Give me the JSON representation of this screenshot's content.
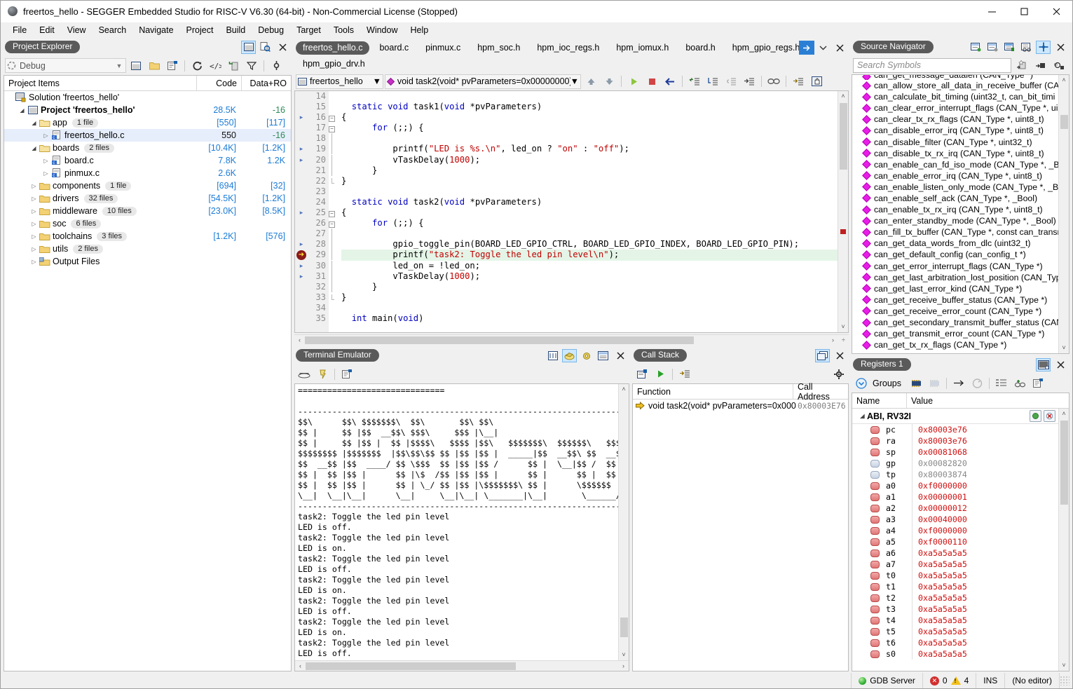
{
  "window": {
    "title": "freertos_hello - SEGGER Embedded Studio for RISC-V V6.30 (64-bit) - Non-Commercial License (Stopped)",
    "app_icon": "segger-icon",
    "minimize": "minimize-icon",
    "maximize": "maximize-icon",
    "close": "close-icon"
  },
  "menubar": [
    "File",
    "Edit",
    "View",
    "Search",
    "Navigate",
    "Project",
    "Build",
    "Debug",
    "Target",
    "Tools",
    "Window",
    "Help"
  ],
  "project_explorer": {
    "title": "Project Explorer",
    "config": "Debug",
    "config_arrow": "▼",
    "columns": [
      "Project Items",
      "Code",
      "Data+RO"
    ],
    "head_icons": [
      "properties-window-icon",
      "search-file-icon",
      "close-icon"
    ],
    "toolbar_icons": [
      "new-item-icon",
      "new-folder-icon",
      "edit-options-icon",
      "refresh-icon",
      "code-icon",
      "import-icon",
      "filter-icon",
      "settings-icon"
    ],
    "rows": [
      {
        "indent": 0,
        "arrow": "",
        "icon": "solution-icon",
        "label": "Solution 'freertos_hello'",
        "badge": "",
        "code": "",
        "data": "",
        "bold": false,
        "selected": false
      },
      {
        "indent": 1,
        "arrow": "open",
        "icon": "project-icon",
        "label": "Project 'freertos_hello'",
        "badge": "",
        "code": "28.5K",
        "data": "-16",
        "bold": true,
        "selected": false
      },
      {
        "indent": 2,
        "arrow": "open",
        "icon": "folder-open-icon",
        "label": "app",
        "badge": "1 file",
        "code": "[550]",
        "data": "[117]",
        "bold": false,
        "selected": false
      },
      {
        "indent": 3,
        "arrow": "closed",
        "icon": "c-file-icon",
        "label": "freertos_hello.c",
        "badge": "",
        "code": "550",
        "data": "-16",
        "bold": false,
        "selected": true
      },
      {
        "indent": 2,
        "arrow": "open",
        "icon": "folder-open-icon",
        "label": "boards",
        "badge": "2 files",
        "code": "[10.4K]",
        "data": "[1.2K]",
        "bold": false,
        "selected": false
      },
      {
        "indent": 3,
        "arrow": "closed",
        "icon": "c-file-icon",
        "label": "board.c",
        "badge": "",
        "code": "7.8K",
        "data": "1.2K",
        "bold": false,
        "selected": false
      },
      {
        "indent": 3,
        "arrow": "closed",
        "icon": "c-file-icon",
        "label": "pinmux.c",
        "badge": "",
        "code": "2.6K",
        "data": "",
        "bold": false,
        "selected": false
      },
      {
        "indent": 2,
        "arrow": "closed",
        "icon": "folder-icon",
        "label": "components",
        "badge": "1 file",
        "code": "[694]",
        "data": "[32]",
        "bold": false,
        "selected": false
      },
      {
        "indent": 2,
        "arrow": "closed",
        "icon": "folder-icon",
        "label": "drivers",
        "badge": "32 files",
        "code": "[54.5K]",
        "data": "[1.2K]",
        "bold": false,
        "selected": false
      },
      {
        "indent": 2,
        "arrow": "closed",
        "icon": "folder-icon",
        "label": "middleware",
        "badge": "10 files",
        "code": "[23.0K]",
        "data": "[8.5K]",
        "bold": false,
        "selected": false
      },
      {
        "indent": 2,
        "arrow": "closed",
        "icon": "folder-icon",
        "label": "soc",
        "badge": "6 files",
        "code": "",
        "data": "",
        "bold": false,
        "selected": false
      },
      {
        "indent": 2,
        "arrow": "closed",
        "icon": "folder-icon",
        "label": "toolchains",
        "badge": "3 files",
        "code": "[1.2K]",
        "data": "[576]",
        "bold": false,
        "selected": false
      },
      {
        "indent": 2,
        "arrow": "closed",
        "icon": "folder-icon",
        "label": "utils",
        "badge": "2 files",
        "code": "",
        "data": "",
        "bold": false,
        "selected": false
      },
      {
        "indent": 2,
        "arrow": "closed",
        "icon": "output-folder-icon",
        "label": "Output Files",
        "badge": "",
        "code": "",
        "data": "",
        "bold": false,
        "selected": false
      }
    ]
  },
  "editor": {
    "tabs": [
      "freertos_hello.c",
      "board.c",
      "pinmux.c",
      "hpm_soc.h",
      "hpm_ioc_regs.h",
      "hpm_iomux.h",
      "board.h",
      "hpm_gpio_regs.h",
      "hpm_gpio_drv.h"
    ],
    "active_tab": "freertos_hello.c",
    "project_selector": "freertos_hello",
    "function_selector": "void task2(void* pvParameters=0x00000000)",
    "toolbar_icons": [
      "step-up-icon",
      "step-down-icon",
      "run-icon",
      "stop-icon",
      "back-icon",
      "step-into-icon",
      "step-over-icon",
      "step-out-icon",
      "run-to-cursor-icon",
      "glasses-icon",
      "next-statement-icon",
      "drag-icon"
    ],
    "current_line": 29,
    "lines": [
      {
        "n": 14,
        "bp": false,
        "fold": "",
        "code": ""
      },
      {
        "n": 15,
        "bp": false,
        "fold": "",
        "code": "  static void task1(void *pvParameters)"
      },
      {
        "n": 16,
        "bp": true,
        "fold": "minus",
        "code": "{"
      },
      {
        "n": 17,
        "bp": false,
        "fold": "minus",
        "code": "      for (;;) {"
      },
      {
        "n": 18,
        "bp": false,
        "fold": "bar",
        "code": ""
      },
      {
        "n": 19,
        "bp": true,
        "fold": "bar",
        "code": "          printf(\"LED is %s.\\n\", led_on ? \"on\" : \"off\");"
      },
      {
        "n": 20,
        "bp": true,
        "fold": "bar",
        "code": "          vTaskDelay(1000);"
      },
      {
        "n": 21,
        "bp": false,
        "fold": "bar",
        "code": "      }"
      },
      {
        "n": 22,
        "bp": false,
        "fold": "end",
        "code": "}"
      },
      {
        "n": 23,
        "bp": false,
        "fold": "",
        "code": ""
      },
      {
        "n": 24,
        "bp": false,
        "fold": "",
        "code": "  static void task2(void *pvParameters)"
      },
      {
        "n": 25,
        "bp": true,
        "fold": "minus",
        "code": "{"
      },
      {
        "n": 26,
        "bp": false,
        "fold": "minus",
        "code": "      for (;;) {"
      },
      {
        "n": 27,
        "bp": false,
        "fold": "bar",
        "code": ""
      },
      {
        "n": 28,
        "bp": true,
        "fold": "bar",
        "code": "          gpio_toggle_pin(BOARD_LED_GPIO_CTRL, BOARD_LED_GPIO_INDEX, BOARD_LED_GPIO_PIN);"
      },
      {
        "n": 29,
        "bp": "pc",
        "fold": "bar",
        "code": "          printf(\"task2: Toggle the led pin level\\n\");"
      },
      {
        "n": 30,
        "bp": true,
        "fold": "bar",
        "code": "          led_on = !led_on;"
      },
      {
        "n": 31,
        "bp": true,
        "fold": "bar",
        "code": "          vTaskDelay(1000);"
      },
      {
        "n": 32,
        "bp": false,
        "fold": "bar",
        "code": "      }"
      },
      {
        "n": 33,
        "bp": false,
        "fold": "end",
        "code": "}"
      },
      {
        "n": 34,
        "bp": false,
        "fold": "",
        "code": ""
      },
      {
        "n": 35,
        "bp": false,
        "fold": "",
        "code": "  int main(void)"
      }
    ]
  },
  "terminal": {
    "title": "Terminal Emulator",
    "head_icons": [
      "connect-icon",
      "terminal-properties-icon",
      "settings-gear-icon",
      "log-icon",
      "close-icon"
    ],
    "toolbar_icons": [
      "modem-icon",
      "phone-icon",
      "properties-icon"
    ],
    "content": "==============================\n\n-----------------------------------------------------------------------\n$$\\      $$\\ $$$$$$$\\  $$\\       $$\\ $$\\\n$$ |     $$ |$$  __$$\\ $$$\\     $$$ |\\__|\n$$ |     $$ |$$ |  $$ |$$$$\\   $$$$ |$$\\   $$$$$$$\\  $$$$$$\\   $$$$$$\\\n$$$$$$$$ |$$$$$$$  |$$\\$$\\$$ $$ |$$ |$$ |  _____|$$  __$$\\ $$  __$$\\\n$$  __$$ |$$  ____/ $$ \\$$$  $$ |$$ |$$ /      $$ |  \\__|$$ /  $$\n$$ |  $$ |$$ |      $$ |\\$  /$$ |$$ |$$ |      $$ |      $$ |  $$\n$$ |  $$ |$$ |      $$ | \\_/ $$ |$$ |\\$$$$$$$\\ $$ |      \\$$$$$$\n\\__|  \\__|\\__|      \\__|     \\__|\\__| \\_______|\\__|       \\______/\n-----------------------------------------------------------------------\ntask2: Toggle the led pin level\nLED is off.\ntask2: Toggle the led pin level\nLED is on.\ntask2: Toggle the led pin level\nLED is off.\ntask2: Toggle the led pin level\nLED is on.\ntask2: Toggle the led pin level\nLED is off.\ntask2: Toggle the led pin level\nLED is on.\ntask2: Toggle the led pin level\nLED is off."
  },
  "call_stack": {
    "title": "Call Stack",
    "head_icons": [
      "callstack-window-icon",
      "close-icon"
    ],
    "toolbar_icons": [
      "show-source-icon",
      "run-to-icon",
      "set-next-icon",
      "settings-gear-icon"
    ],
    "columns": [
      "Function",
      "Call Address"
    ],
    "rows": [
      {
        "icon": "current-frame-icon",
        "function": "void task2(void* pvParameters=0x000",
        "address": "0x80003E76"
      }
    ]
  },
  "source_navigator": {
    "title": "Source Navigator",
    "head_icons": [
      "sort-icon",
      "group-icon",
      "list-icon",
      "filter-icon",
      "pin-icon",
      "close-icon"
    ],
    "search_placeholder": "Search Symbols",
    "search_icons": [
      "new-symbol-icon",
      "goto-symbol-icon",
      "find-symbol-icon"
    ],
    "symbols": [
      "can_get_message_datalen (CAN_Type *)",
      "can_allow_store_all_data_in_receive_buffer (CAN",
      "can_calculate_bit_timing (uint32_t, can_bit_timi",
      "can_clear_error_interrupt_flags (CAN_Type *, uin",
      "can_clear_tx_rx_flags (CAN_Type *, uint8_t)",
      "can_disable_error_irq (CAN_Type *, uint8_t)",
      "can_disable_filter (CAN_Type *, uint32_t)",
      "can_disable_tx_rx_irq (CAN_Type *, uint8_t)",
      "can_enable_can_fd_iso_mode (CAN_Type *, _Bo",
      "can_enable_error_irq (CAN_Type *, uint8_t)",
      "can_enable_listen_only_mode (CAN_Type *, _Bc",
      "can_enable_self_ack (CAN_Type *, _Bool)",
      "can_enable_tx_rx_irq (CAN_Type *, uint8_t)",
      "can_enter_standby_mode (CAN_Type *, _Bool)",
      "can_fill_tx_buffer (CAN_Type *, const can_transr",
      "can_get_data_words_from_dlc (uint32_t)",
      "can_get_default_config (can_config_t *)",
      "can_get_error_interrupt_flags (CAN_Type *)",
      "can_get_last_arbitration_lost_position (CAN_Typ",
      "can_get_last_error_kind (CAN_Type *)",
      "can_get_receive_buffer_status (CAN_Type *)",
      "can_get_receive_error_count (CAN_Type *)",
      "can_get_secondary_transmit_buffer_status (CAN",
      "can_get_transmit_error_count (CAN_Type *)",
      "can_get_tx_rx_flags (CAN_Type *)"
    ]
  },
  "registers": {
    "title": "Registers 1",
    "head_icons": [
      "registers-window-icon",
      "close-icon"
    ],
    "toolbar": {
      "groups_label": "Groups",
      "icons": [
        "groups-dropdown-icon",
        "chip-icon",
        "chip-disabled-icon",
        "arrow-right-icon",
        "refresh-icon",
        "columns-icon",
        "add-watch-icon",
        "properties-icon"
      ]
    },
    "columns": [
      "Name",
      "Value"
    ],
    "group_name": "ABI, RV32I",
    "group_buttons": [
      "refresh-group-icon",
      "remove-group-icon"
    ],
    "rows": [
      {
        "name": "pc",
        "value": "0x80003e76",
        "changed": true
      },
      {
        "name": "ra",
        "value": "0x80003e76",
        "changed": true
      },
      {
        "name": "sp",
        "value": "0x00081068",
        "changed": true
      },
      {
        "name": "gp",
        "value": "0x00082820",
        "changed": false
      },
      {
        "name": "tp",
        "value": "0x80003874",
        "changed": false
      },
      {
        "name": "a0",
        "value": "0xf0000000",
        "changed": true
      },
      {
        "name": "a1",
        "value": "0x00000001",
        "changed": true
      },
      {
        "name": "a2",
        "value": "0x00000012",
        "changed": true
      },
      {
        "name": "a3",
        "value": "0x00040000",
        "changed": true
      },
      {
        "name": "a4",
        "value": "0xf0000000",
        "changed": true
      },
      {
        "name": "a5",
        "value": "0xf0000110",
        "changed": true
      },
      {
        "name": "a6",
        "value": "0xa5a5a5a5",
        "changed": true
      },
      {
        "name": "a7",
        "value": "0xa5a5a5a5",
        "changed": true
      },
      {
        "name": "t0",
        "value": "0xa5a5a5a5",
        "changed": true
      },
      {
        "name": "t1",
        "value": "0xa5a5a5a5",
        "changed": true
      },
      {
        "name": "t2",
        "value": "0xa5a5a5a5",
        "changed": true
      },
      {
        "name": "t3",
        "value": "0xa5a5a5a5",
        "changed": true
      },
      {
        "name": "t4",
        "value": "0xa5a5a5a5",
        "changed": true
      },
      {
        "name": "t5",
        "value": "0xa5a5a5a5",
        "changed": true
      },
      {
        "name": "t6",
        "value": "0xa5a5a5a5",
        "changed": true
      },
      {
        "name": "s0",
        "value": "0xa5a5a5a5",
        "changed": true
      }
    ]
  },
  "statusbar": {
    "gdb_label": "GDB Server",
    "error_count": "0",
    "warning_count": "4",
    "insert_mode": "INS",
    "editor_state": "(No editor)"
  }
}
